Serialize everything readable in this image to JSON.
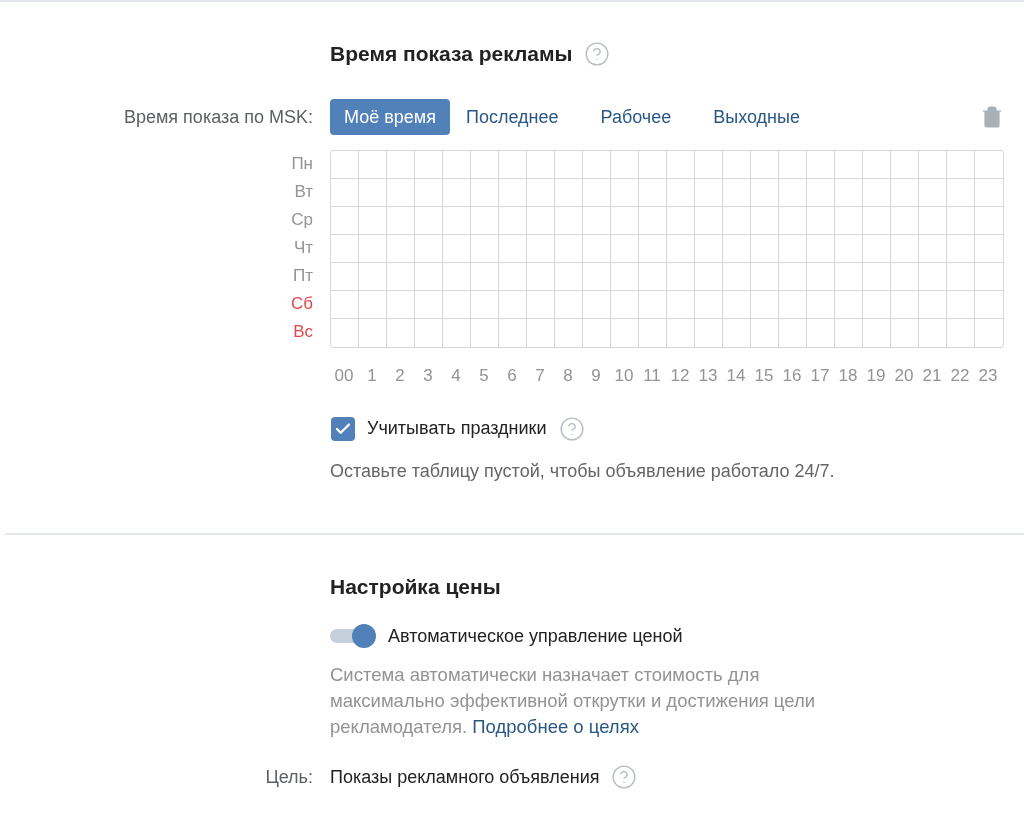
{
  "schedule": {
    "title": "Время показа рекламы",
    "time_label": "Время показа по MSK:",
    "presets": [
      {
        "label": "Моё время",
        "selected": true
      },
      {
        "label": "Последнее",
        "selected": false
      },
      {
        "label": "Рабочее",
        "selected": false
      },
      {
        "label": "Выходные",
        "selected": false
      }
    ],
    "days": [
      {
        "label": "Пн",
        "weekend": false
      },
      {
        "label": "Вт",
        "weekend": false
      },
      {
        "label": "Ср",
        "weekend": false
      },
      {
        "label": "Чт",
        "weekend": false
      },
      {
        "label": "Пт",
        "weekend": false
      },
      {
        "label": "Сб",
        "weekend": true
      },
      {
        "label": "Вс",
        "weekend": true
      }
    ],
    "hours": [
      "00",
      "1",
      "2",
      "3",
      "4",
      "5",
      "6",
      "7",
      "8",
      "9",
      "10",
      "11",
      "12",
      "13",
      "14",
      "15",
      "16",
      "17",
      "18",
      "19",
      "20",
      "21",
      "22",
      "23"
    ],
    "holidays": {
      "label": "Учитывать праздники",
      "checked": true
    },
    "hint": "Оставьте таблицу пустой, чтобы объявление работало 24/7."
  },
  "price": {
    "title": "Настройка цены",
    "auto": {
      "label": "Автоматическое управление ценой",
      "on": true
    },
    "description": "Система автоматически назначает стоимость для максимально эффективной открутки и достижения цели рекламодателя.",
    "link": "Подробнее о целях",
    "goal": {
      "label": "Цель:",
      "value": "Показы рекламного объявления"
    }
  }
}
